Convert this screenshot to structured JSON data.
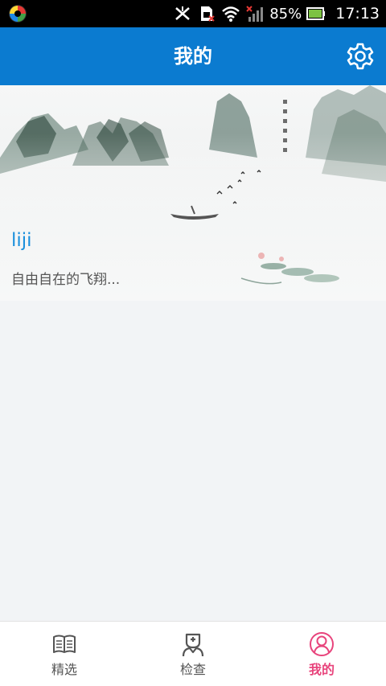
{
  "status_bar": {
    "battery": "85%",
    "time": "17:13"
  },
  "header": {
    "title": "我的"
  },
  "profile": {
    "username": "liji",
    "signature": "自由自在的飞翔..."
  },
  "bottom_nav": {
    "items": [
      {
        "label": "精选",
        "icon": "book-icon",
        "active": false
      },
      {
        "label": "检查",
        "icon": "doctor-icon",
        "active": false
      },
      {
        "label": "我的",
        "icon": "user-icon",
        "active": true
      }
    ]
  },
  "colors": {
    "header": "#0b7bd0",
    "active": "#e8447c",
    "username": "#1a8fdc"
  }
}
